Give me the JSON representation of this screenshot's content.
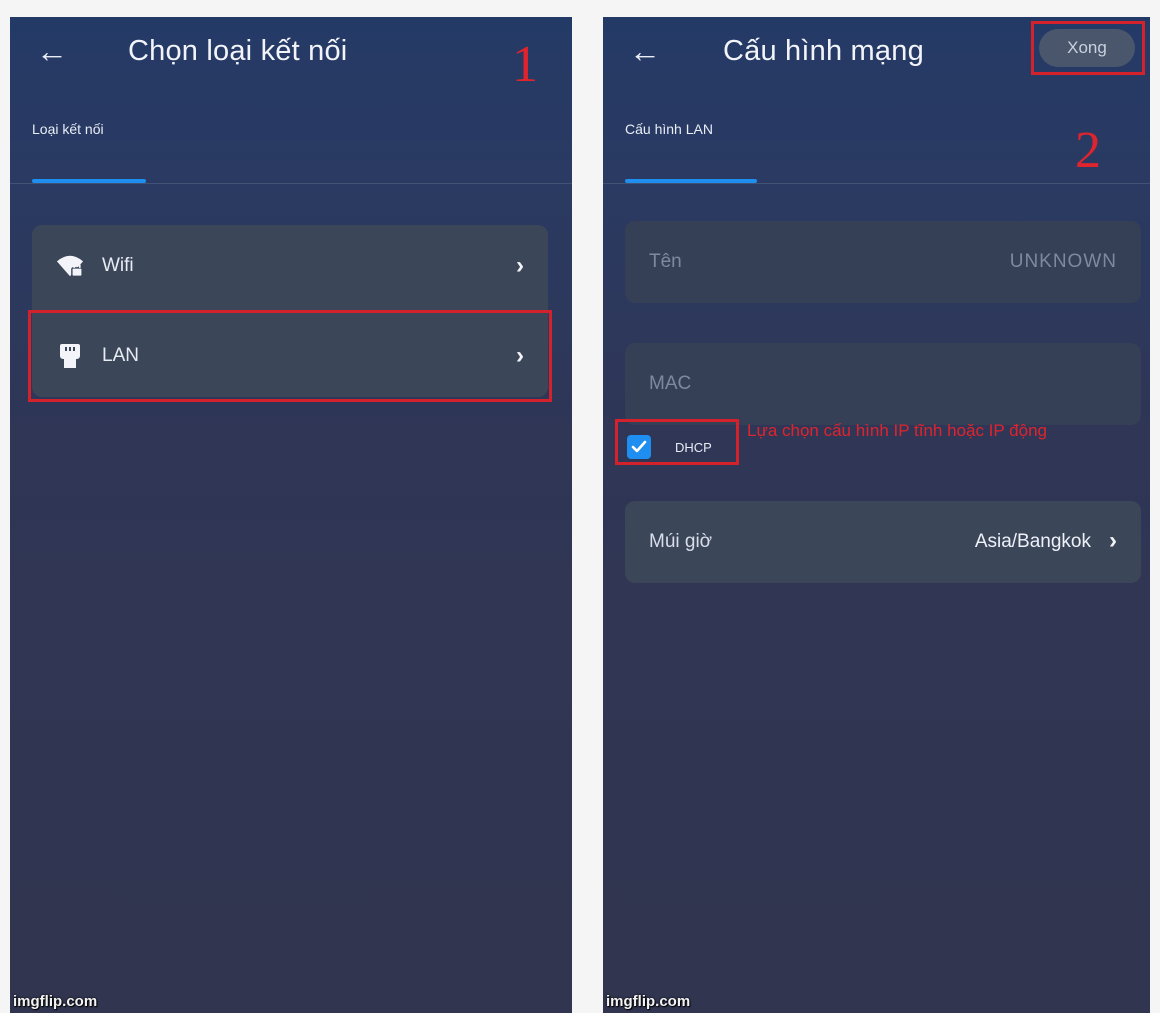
{
  "left_screen": {
    "title": "Chọn loại kết nối",
    "tab_label": "Loại kết nối",
    "items": [
      {
        "label": "Wifi",
        "icon": "wifi-lock-icon"
      },
      {
        "label": "LAN",
        "icon": "ethernet-plug-icon"
      }
    ],
    "annotation_number": "1",
    "watermark": "imgflip.com"
  },
  "right_screen": {
    "title": "Cấu hình mạng",
    "done_button": "Xong",
    "tab_label": "Cấu hình LAN",
    "fields": [
      {
        "label": "Tên",
        "value": "UNKNOWN"
      },
      {
        "label": "MAC",
        "value": ""
      }
    ],
    "dhcp": {
      "label": "DHCP",
      "checked": true
    },
    "annotation_note": "Lựa chọn cấu hình IP tĩnh hoặc IP động",
    "timezone": {
      "label": "Múi giờ",
      "value": "Asia/Bangkok"
    },
    "annotation_number": "2",
    "watermark": "imgflip.com"
  },
  "colors": {
    "accent": "#1e8ff0",
    "annotation_red": "#d3222c",
    "card_bg": "#3b4658"
  }
}
